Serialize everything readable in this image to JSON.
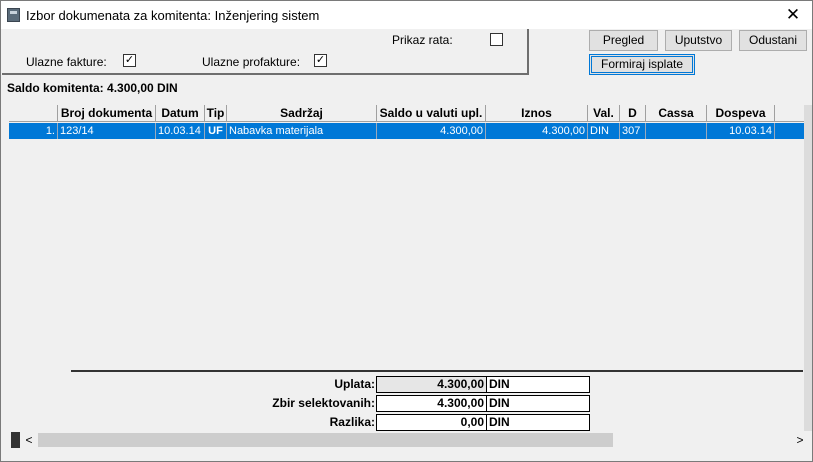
{
  "window": {
    "title": "Izbor dokumenata za komitenta: Inženjering sistem",
    "close_glyph": "✕"
  },
  "filters": {
    "prikaz_rata_label": "Prikaz rata:",
    "prikaz_rata_checked": false,
    "ulazne_fakture_label": "Ulazne fakture:",
    "ulazne_fakture_checked": true,
    "ulazne_profakture_label": "Ulazne profakture:",
    "ulazne_profakture_checked": true,
    "check_glyph": "✓"
  },
  "buttons": {
    "pregled": "Pregled",
    "uputstvo": "Uputstvo",
    "odustani": "Odustani",
    "formiraj": "Formiraj isplate"
  },
  "saldo": "Saldo komitenta:  4.300,00 DIN",
  "grid": {
    "columns": [
      "",
      "Broj dokumenta",
      "Datum",
      "Tip",
      "Sadržaj",
      "Saldo u valuti upl.",
      "Iznos",
      "Val.",
      "D",
      "Cassa",
      "Dospeva",
      ""
    ],
    "rows": [
      {
        "num": "1.",
        "broj": "123/14",
        "datum": "10.03.14",
        "tip": "UF",
        "sadrzaj": "Nabavka materijala",
        "saldo": "4.300,00",
        "iznos": "4.300,00",
        "val": "DIN",
        "d": "307",
        "cassa": "",
        "dospeva": "10.03.14"
      }
    ]
  },
  "summary": {
    "uplata_label": "Uplata:",
    "uplata_value": "4.300,00",
    "uplata_currency": "DIN",
    "zbir_label": "Zbir selektovanih:",
    "zbir_value": "4.300,00",
    "zbir_currency": "DIN",
    "razlika_label": "Razlika:",
    "razlika_value": "0,00",
    "razlika_currency": "DIN"
  },
  "scrollbar": {
    "left_arrow": "<",
    "right_arrow": ">"
  }
}
